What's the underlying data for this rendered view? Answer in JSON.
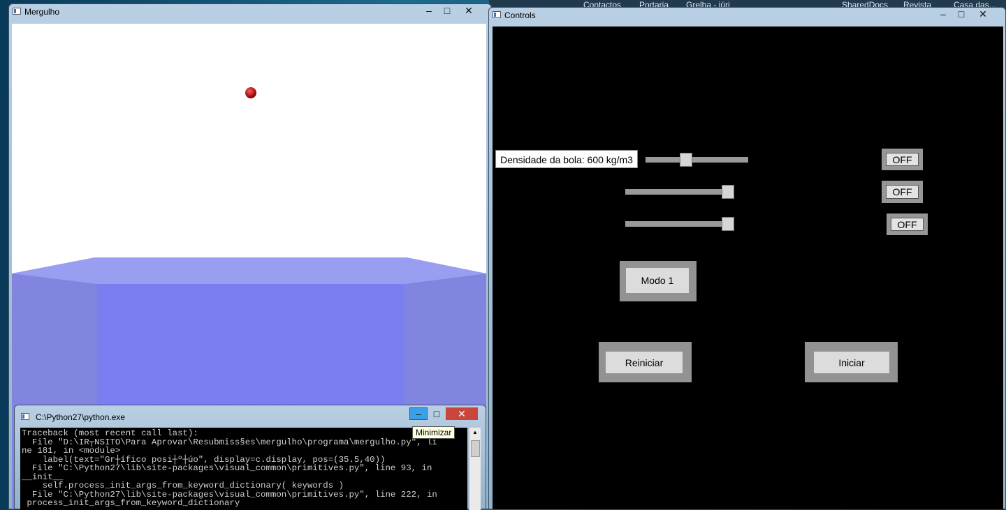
{
  "background": {
    "taskbar_items": [
      "Contactos",
      "Portaria",
      "Grelha - júri",
      "SharedDocs",
      "Revista",
      "Casa das..."
    ]
  },
  "mergulho_window": {
    "title": "Mergulho",
    "ball_color": "#cc0000",
    "water_color": "#7a7ef0"
  },
  "controls_window": {
    "title": "Controls",
    "density_label": "Densidade da bola: 600 kg/m3",
    "sliders": [
      {
        "name": "densidade",
        "value": 0.38
      },
      {
        "name": "slider-2",
        "value": 1.0
      },
      {
        "name": "slider-3",
        "value": 1.0
      }
    ],
    "toggles": [
      "OFF",
      "OFF",
      "OFF"
    ],
    "mode_button": "Modo 1",
    "restart_button": "Reiniciar",
    "start_button": "Iniciar"
  },
  "console_window": {
    "title": "C:\\Python27\\python.exe",
    "tooltip": "Minimizar",
    "lines": [
      "Traceback (most recent call last):",
      "  File \"D:\\IR┬NSITO\\Para Aprovar\\Resubmiss§es\\mergulho\\programa\\mergulho.py\", li",
      "ne 181, in <module>",
      "    label(text=\"Gr┼ífico posi┼º┼úo\", display=c.display, pos=(35.5,40))",
      "  File \"C:\\Python27\\lib\\site-packages\\visual_common\\primitives.py\", line 93, in",
      "__init__",
      "    self.process_init_args_from_keyword_dictionary( keywords )",
      "  File \"C:\\Python27\\lib\\site-packages\\visual_common\\primitives.py\", line 222, in",
      " process_init_args_from_keyword_dictionary"
    ]
  }
}
